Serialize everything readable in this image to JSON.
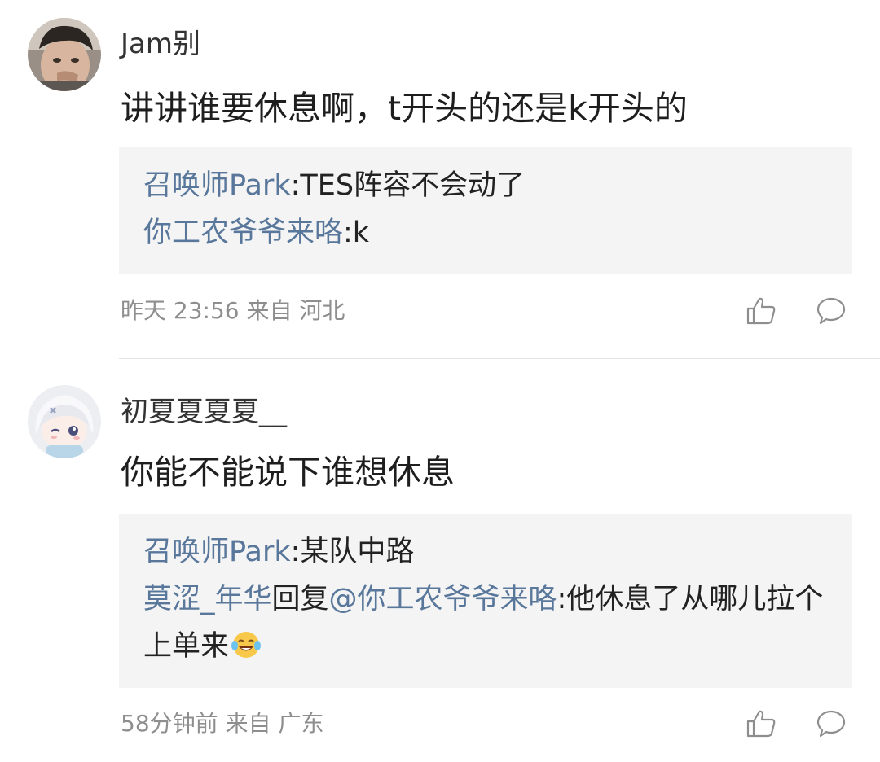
{
  "comments": [
    {
      "username": "Jam别",
      "content": "讲讲谁要休息啊，t开头的还是k开头的",
      "replies": [
        {
          "name": "召唤师Park",
          "text": ":TES阵容不会动了"
        },
        {
          "name": "你工农爷爷来咯",
          "text": ":k"
        }
      ],
      "time": "昨天 23:56",
      "location": "来自 河北"
    },
    {
      "username": "初夏夏夏夏__",
      "content": "你能不能说下谁想休息",
      "replies": [
        {
          "name": "召唤师Park",
          "text": ":某队中路"
        },
        {
          "name": "莫涩_年华",
          "between": "回复",
          "mention": "@你工农爷爷来咯",
          "text": ":他休息了从哪儿拉个上单来"
        }
      ],
      "time": "58分钟前",
      "location": "来自 广东"
    }
  ],
  "icons": {
    "like": "thumbs-up-icon",
    "reply": "comment-bubble-icon",
    "emoji": "laughing-tears-emoji"
  },
  "colors": {
    "reply_name": "#58779b",
    "meta": "#8e8e8e",
    "reply_box": "#f4f4f4"
  }
}
